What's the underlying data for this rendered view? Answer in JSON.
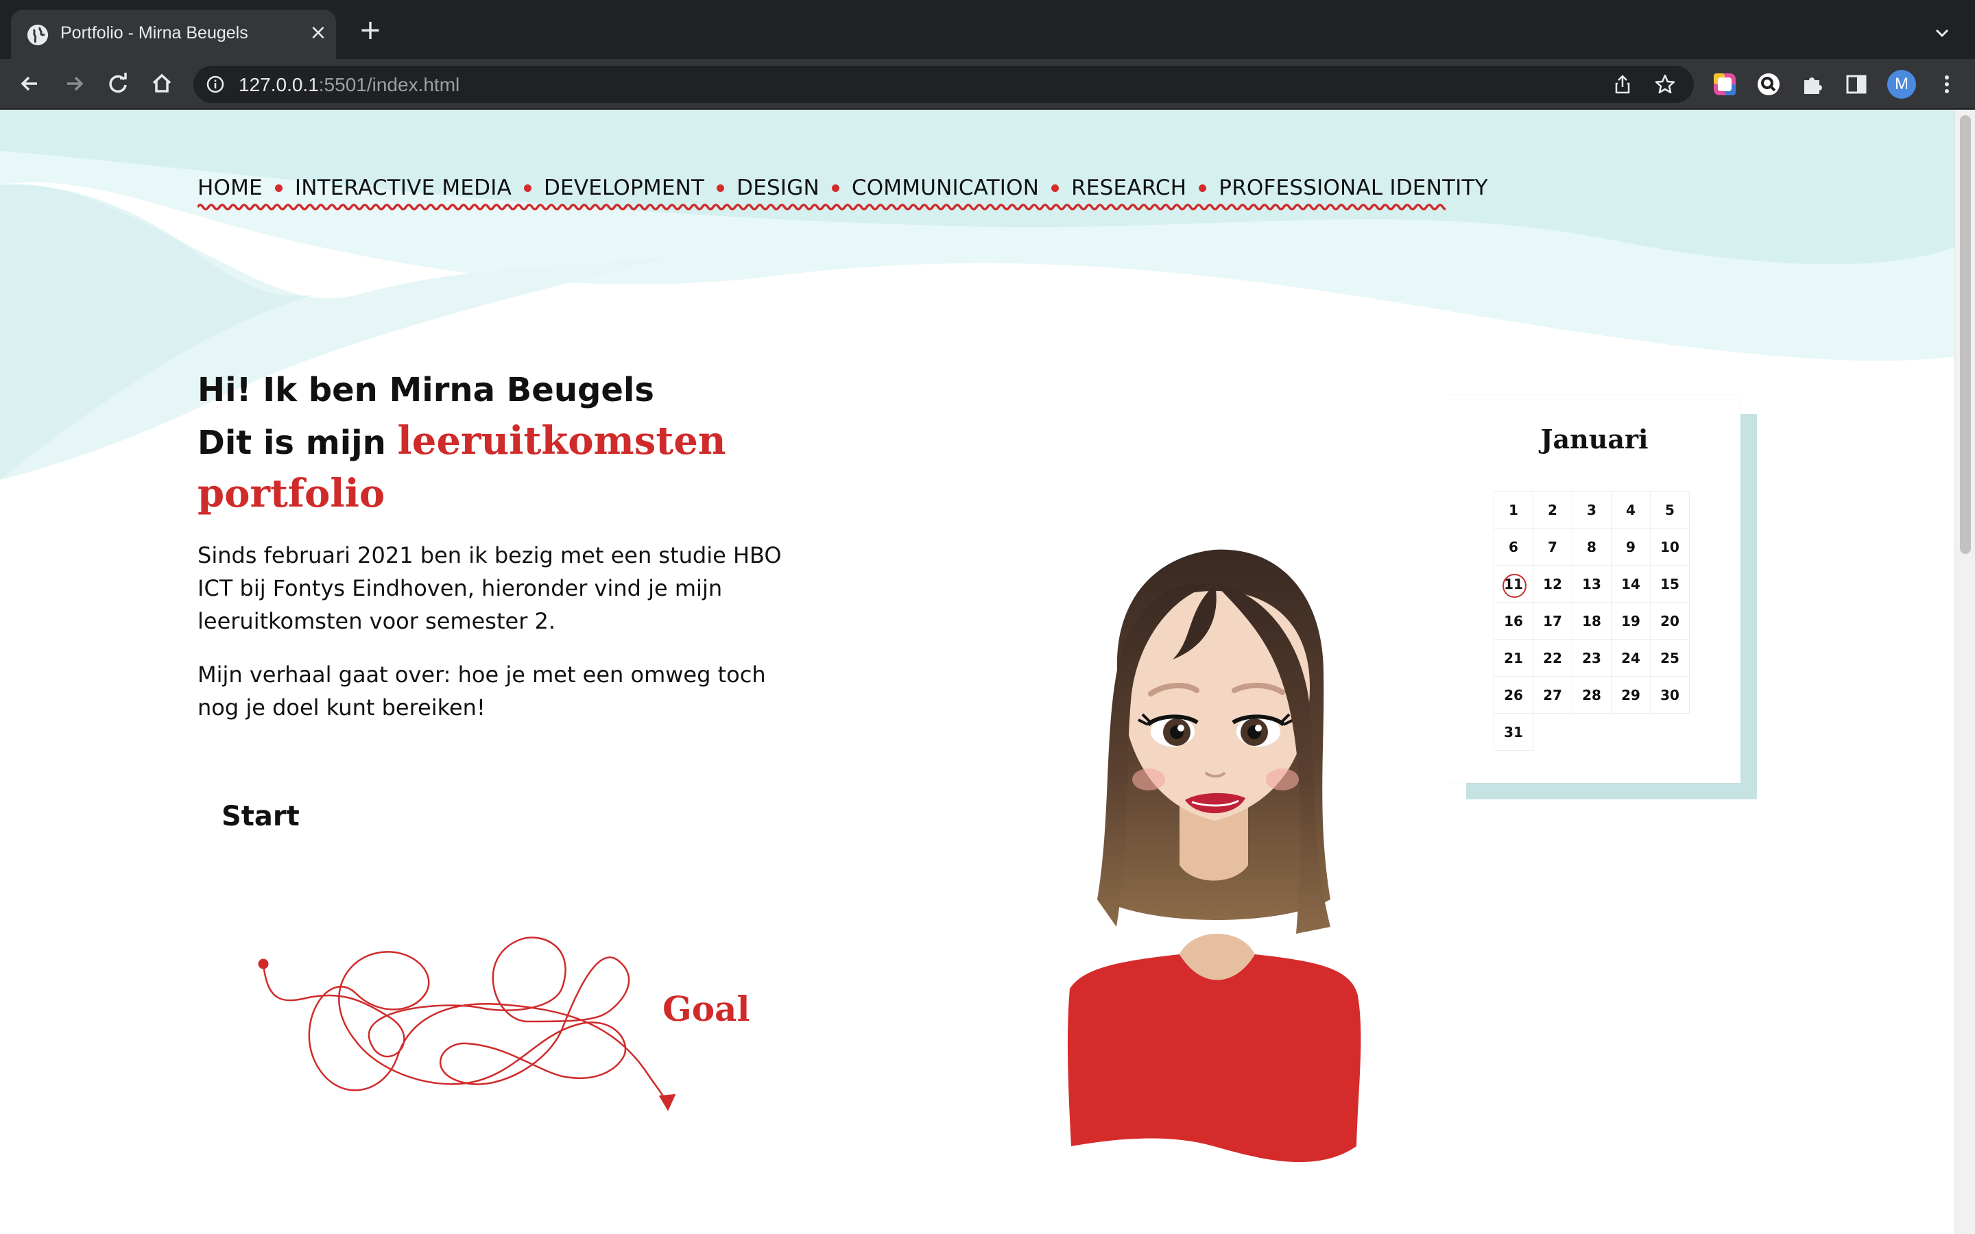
{
  "browser": {
    "tab_title": "Portfolio - Mirna Beugels",
    "url_host": "127.0.0.1",
    "url_rest": ":5501/index.html",
    "profile_initial": "M"
  },
  "nav": {
    "items": [
      "HOME",
      "INTERACTIVE MEDIA",
      "DEVELOPMENT",
      "DESIGN",
      "COMMUNICATION",
      "RESEARCH",
      "PROFESSIONAL IDENTITY"
    ]
  },
  "hero": {
    "line1": "Hi! Ik ben Mirna Beugels",
    "line2_prefix": "Dit is mijn ",
    "line2_highlight": "leeruitkomsten",
    "line3": "portfolio",
    "paragraph1": "Sinds februari 2021 ben ik bezig met een studie HBO ICT bij Fontys Eindhoven, hieronder vind je mijn leeruitkomsten voor semester 2.",
    "paragraph2": "Mijn verhaal gaat over: hoe je met een omweg toch nog je doel kunt bereiken!"
  },
  "journey": {
    "start": "Start",
    "goal": "Goal"
  },
  "calendar": {
    "month": "Januari",
    "days": [
      "1",
      "2",
      "3",
      "4",
      "5",
      "6",
      "7",
      "8",
      "9",
      "10",
      "11",
      "12",
      "13",
      "14",
      "15",
      "16",
      "17",
      "18",
      "19",
      "20",
      "21",
      "22",
      "23",
      "24",
      "25",
      "26",
      "27",
      "28",
      "29",
      "30",
      "31"
    ],
    "highlighted_day": "11"
  },
  "colors": {
    "accent_red": "#d02b2b",
    "wave_teal": "#d4efef",
    "calendar_shadow": "#c6e3e3",
    "chrome_dark": "#202124"
  },
  "icons": {
    "favicon": "globe-icon",
    "back": "arrow-left-icon",
    "forward": "arrow-right-icon",
    "reload": "reload-icon",
    "home": "home-icon",
    "info": "info-icon",
    "share": "share-icon",
    "bookmark": "star-icon",
    "extensions": "puzzle-icon",
    "side_panel": "side-panel-icon",
    "menu": "kebab-menu-icon"
  }
}
